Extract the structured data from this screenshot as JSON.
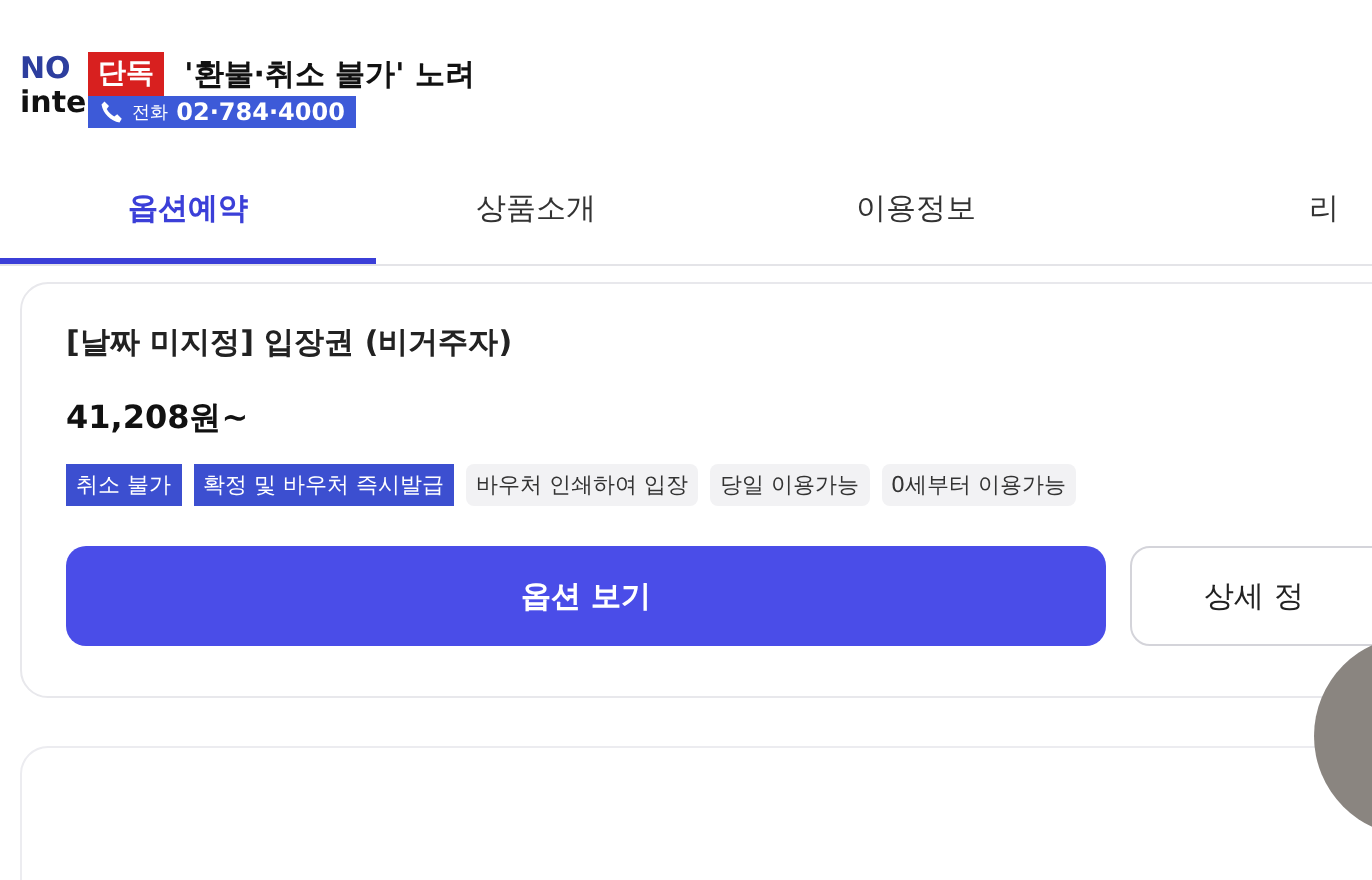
{
  "logo": {
    "line_1": "NO",
    "line_2": "inte"
  },
  "news_overlay": {
    "badge": "단독",
    "headline": "'환불·취소 불가' 노려",
    "phone_label": "전화",
    "phone_number": "02·784·4000"
  },
  "tabs": [
    {
      "label": "옵션예약",
      "selected": true
    },
    {
      "label": "상품소개",
      "selected": false
    },
    {
      "label": "이용정보",
      "selected": false
    },
    {
      "label": "리",
      "selected": false
    }
  ],
  "product": {
    "title": "[날짜 미지정] 입장권 (비거주자)",
    "price": "41,208원~",
    "tags": [
      {
        "label": "취소 불가",
        "highlighted": true
      },
      {
        "label": "확정 및 바우처 즉시발급",
        "highlighted": true
      },
      {
        "label": "바우처 인쇄하여 입장",
        "highlighted": false
      },
      {
        "label": "당일 이용가능",
        "highlighted": false
      },
      {
        "label": "0세부터 이용가능",
        "highlighted": false
      }
    ],
    "primary_button": "옵션 보기",
    "secondary_button": "상세 정"
  }
}
